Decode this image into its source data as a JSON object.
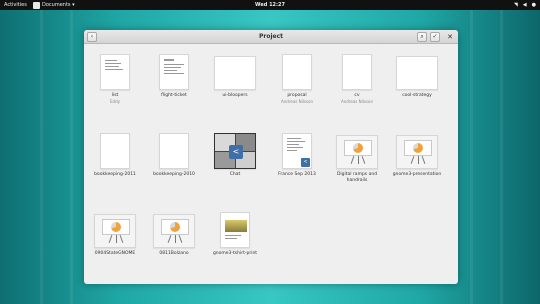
{
  "topbar": {
    "activities": "Activities",
    "app_menu": "Documents ▾",
    "clock": "Wed 12:27"
  },
  "window": {
    "title": "Project",
    "back_icon": "back-arrow-icon",
    "search_icon": "search-icon",
    "select_icon": "checkmark-icon",
    "close_icon": "close-icon"
  },
  "documents": [
    {
      "name": "list",
      "author": "Eddy"
    },
    {
      "name": "flight-ticket",
      "author": ""
    },
    {
      "name": "ui-bloopers",
      "author": ""
    },
    {
      "name": "proposal",
      "author": "Andreas Nilsson"
    },
    {
      "name": "cv",
      "author": "Andreas Nilsson"
    },
    {
      "name": "cool-strategy",
      "author": ""
    },
    {
      "name": "bookkeeping-2011",
      "author": ""
    },
    {
      "name": "bookkeeping-2010",
      "author": ""
    },
    {
      "name": "Chat",
      "author": ""
    },
    {
      "name": "France Sep 2013",
      "author": ""
    },
    {
      "name": "Digital ramps and handrails",
      "author": ""
    },
    {
      "name": "gnome3-presentation",
      "author": ""
    },
    {
      "name": "0904StateGNOME",
      "author": ""
    },
    {
      "name": "0811Bolzano",
      "author": ""
    },
    {
      "name": "gnome3-tshirt-print",
      "author": ""
    }
  ],
  "colors": {
    "desktop": "#2ab6b3",
    "topbar": "#111111",
    "window": "#efefef",
    "pie_accent": "#f2a23a",
    "badge": "#3f6ea8"
  }
}
